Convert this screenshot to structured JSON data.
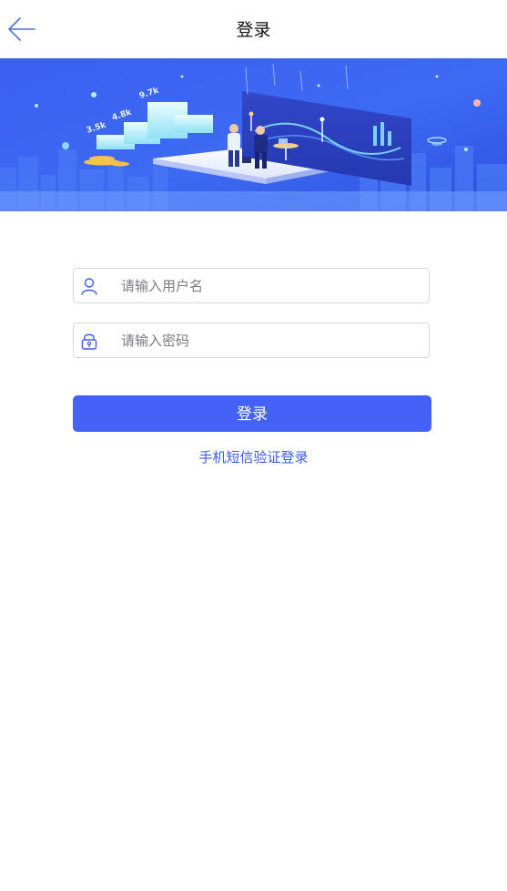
{
  "header": {
    "title": "登录",
    "back_icon": "arrow-left-icon"
  },
  "banner": {
    "bar_labels": [
      "3.5k",
      "4.8k",
      "9.7k"
    ]
  },
  "form": {
    "username": {
      "placeholder": "请输入用户名",
      "value": "",
      "icon": "user-icon"
    },
    "password": {
      "placeholder": "请输入密码",
      "value": "",
      "icon": "lock-icon"
    },
    "login_label": "登录",
    "sms_login_label": "手机短信验证登录"
  },
  "colors": {
    "accent": "#4462f8",
    "link": "#3a5de6",
    "banner_primary": "#3f63f2"
  }
}
